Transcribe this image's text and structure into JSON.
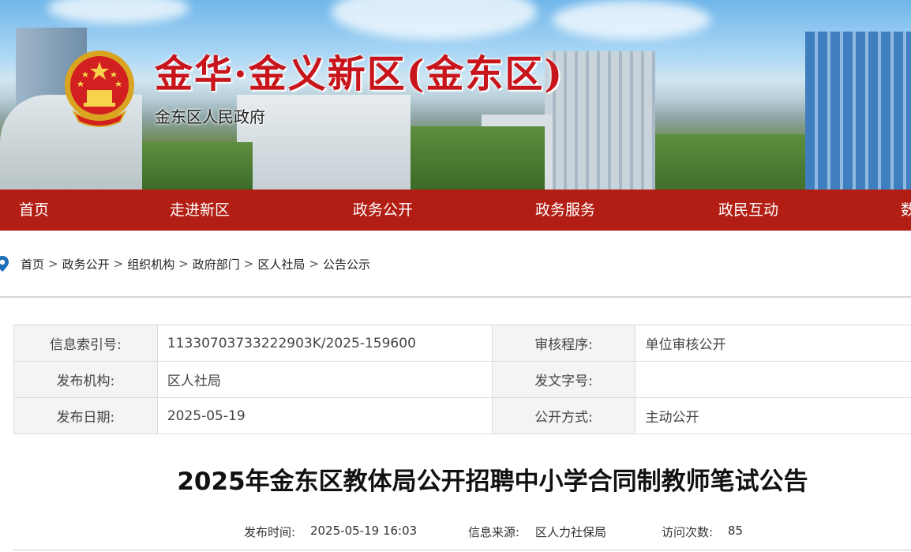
{
  "site": {
    "title": "金华·金义新区(金东区)",
    "subtitle": "金东区人民政府"
  },
  "nav": {
    "items": [
      "首页",
      "走进新区",
      "政务公开",
      "政务服务",
      "政民互动",
      "数"
    ]
  },
  "breadcrumb": [
    "首页",
    "政务公开",
    "组织机构",
    "政府部门",
    "区人社局",
    "公告公示"
  ],
  "breadcrumb_separator": ">",
  "info": {
    "rows": [
      {
        "label1": "信息索引号:",
        "value1": "11330703733222903K/2025-159600",
        "label2": "审核程序:",
        "value2": "单位审核公开"
      },
      {
        "label1": "发布机构:",
        "value1": "区人社局",
        "label2": "发文字号:",
        "value2": ""
      },
      {
        "label1": "发布日期:",
        "value1": "2025-05-19",
        "label2": "公开方式:",
        "value2": "主动公开"
      }
    ]
  },
  "article": {
    "title": "2025年金东区教体局公开招聘中小学合同制教师笔试公告",
    "meta_time_label": "发布时间:",
    "meta_time": "2025-05-19 16:03",
    "meta_source_label": "信息来源:",
    "meta_source": "区人力社保局",
    "meta_visits_label": "访问次数:",
    "meta_visits": "85"
  },
  "colors": {
    "nav_bg": "#b21e13",
    "title_red": "#c8151b",
    "label_bg": "#f3f4f6"
  }
}
